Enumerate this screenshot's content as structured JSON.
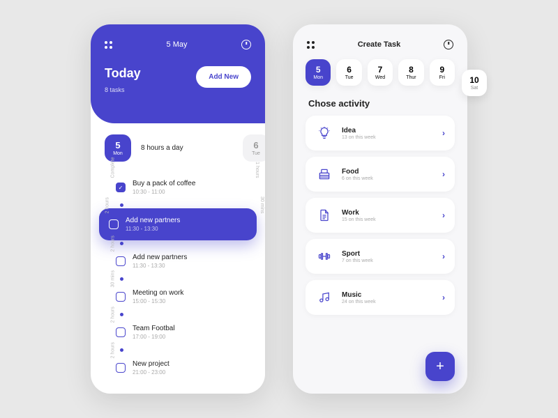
{
  "left": {
    "date_title": "5  May",
    "heading": "Today",
    "task_count": "8 tasks",
    "add_button": "Add New",
    "day_main": {
      "num": "5",
      "abbr": "Mon"
    },
    "day_label": "8 hours a day",
    "day_next": {
      "num": "6",
      "abbr": "Tue"
    },
    "tasks": [
      {
        "name": "Buy a pack of coffee",
        "time": "10:30 - 11:00",
        "left": "Complete",
        "right": "1 hours",
        "checked": true
      },
      {
        "name": "Add new partners",
        "time": "11:30 - 13:30",
        "left": "2 hours",
        "right": "30 mins",
        "hl": true
      },
      {
        "name": "Add new partners",
        "time": "11:30 - 13:30",
        "left": "2 hours"
      },
      {
        "name": "Meeting on work",
        "time": "15:00 - 15:30",
        "left": "30 mins"
      },
      {
        "name": "Team Footbal",
        "time": "17:00 - 19:00",
        "left": "2 hours"
      },
      {
        "name": "New project",
        "time": "21:00 - 23:00",
        "left": "2 hours"
      }
    ]
  },
  "right": {
    "title": "Create Task",
    "dates": [
      {
        "num": "5",
        "abbr": "Mon",
        "sel": true
      },
      {
        "num": "6",
        "abbr": "Tue"
      },
      {
        "num": "7",
        "abbr": "Wed"
      },
      {
        "num": "8",
        "abbr": "Thur"
      },
      {
        "num": "9",
        "abbr": "Fri"
      }
    ],
    "date_extra": {
      "num": "10",
      "abbr": "Sat"
    },
    "section": "Chose activity",
    "activities": [
      {
        "name": "Idea",
        "sub": "13 on this week",
        "icon": "idea"
      },
      {
        "name": "Food",
        "sub": "6 on this week",
        "icon": "food"
      },
      {
        "name": "Work",
        "sub": "15 on this week",
        "icon": "work"
      },
      {
        "name": "Sport",
        "sub": "7 on this week",
        "icon": "sport"
      },
      {
        "name": "Music",
        "sub": "24 on this week",
        "icon": "music"
      }
    ]
  }
}
